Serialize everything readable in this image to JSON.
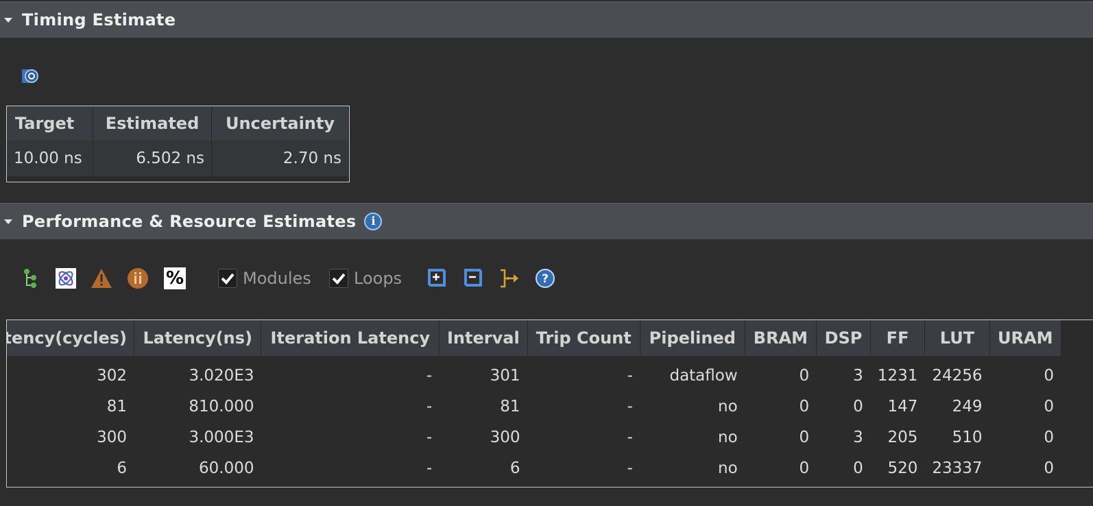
{
  "sections": {
    "timing": {
      "title": "Timing Estimate"
    },
    "performance": {
      "title": "Performance & Resource Estimates"
    }
  },
  "timing_table": {
    "headers": [
      "Target",
      "Estimated",
      "Uncertainty"
    ],
    "row": [
      "10.00 ns",
      "6.502 ns",
      "2.70 ns"
    ]
  },
  "toolbar": {
    "icons": [
      "hierarchy-icon",
      "schedule-viewer-icon",
      "warning-icon",
      "interface-icon",
      "percent-icon",
      "expand-all-icon",
      "collapse-all-icon",
      "dataflow-icon",
      "help-icon"
    ],
    "modules_label": "Modules",
    "modules_checked": true,
    "loops_label": "Loops",
    "loops_checked": true,
    "percent_glyph": "%"
  },
  "perf_table": {
    "headers": [
      "Latency(cycles)",
      "Latency(ns)",
      "Iteration Latency",
      "Interval",
      "Trip Count",
      "Pipelined",
      "BRAM",
      "DSP",
      "FF",
      "LUT",
      "URAM"
    ],
    "rows": [
      [
        "302",
        "3.020E3",
        "-",
        "301",
        "-",
        "dataflow",
        "0",
        "3",
        "1231",
        "24256",
        "0"
      ],
      [
        "81",
        "810.000",
        "-",
        "81",
        "-",
        "no",
        "0",
        "0",
        "147",
        "249",
        "0"
      ],
      [
        "300",
        "3.000E3",
        "-",
        "300",
        "-",
        "no",
        "0",
        "3",
        "205",
        "510",
        "0"
      ],
      [
        "6",
        "60.000",
        "-",
        "6",
        "-",
        "no",
        "0",
        "0",
        "520",
        "23337",
        "0"
      ]
    ]
  }
}
